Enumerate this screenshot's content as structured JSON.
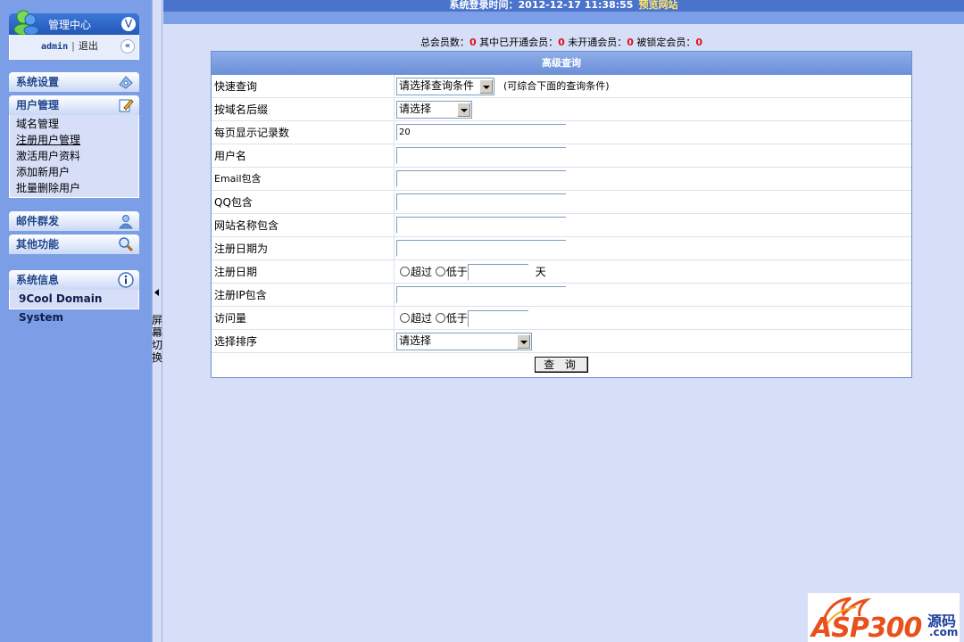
{
  "sidebar": {
    "manager": {
      "title": "管理中心",
      "user": "admin",
      "logout": "退出"
    },
    "sections": [
      {
        "title": "系统设置"
      },
      {
        "title": "用户管理",
        "items": [
          "域名管理",
          "注册用户管理",
          "激活用户资料",
          "添加新用户",
          "批量删除用户"
        ]
      },
      {
        "title": "邮件群发"
      },
      {
        "title": "其他功能"
      },
      {
        "title": "系统信息",
        "items": [
          "9Cool Domain System"
        ]
      }
    ]
  },
  "splitter": {
    "label": "屏幕切换"
  },
  "topbar": {
    "login_time": "系统登录时间：2012-12-17 11:38:55",
    "preview": "预览网站"
  },
  "stats": {
    "total_label": "总会员数：",
    "total": "0",
    "active_label": "其中已开通会员：",
    "active": "0",
    "inactive_label": "未开通会员：",
    "inactive": "0",
    "locked_label": "被锁定会员：",
    "locked": "0"
  },
  "query": {
    "title": "高级查询",
    "quick": {
      "label": "快速查询",
      "value": "请选择查询条件",
      "hint": "(可综合下面的查询条件)"
    },
    "suffix": {
      "label": "按域名后缀",
      "value": "请选择"
    },
    "per_page": {
      "label": "每页显示记录数",
      "value": "20"
    },
    "username": {
      "label": "用户名",
      "value": ""
    },
    "email": {
      "label": "Email包含",
      "value": ""
    },
    "qq": {
      "label": "QQ包含",
      "value": ""
    },
    "site_name": {
      "label": "网站名称包含",
      "value": ""
    },
    "reg_date_is": {
      "label": "注册日期为",
      "value": ""
    },
    "reg_date": {
      "label": "注册日期",
      "over": "超过",
      "under": "低于",
      "unit": "天"
    },
    "reg_ip": {
      "label": "注册IP包含",
      "value": ""
    },
    "visits": {
      "label": "访问量",
      "over": "超过",
      "under": "低于"
    },
    "sort": {
      "label": "选择排序",
      "value": "请选择"
    },
    "submit": "查 询"
  },
  "logo": {
    "brand": "ASP300",
    "tag": "源码",
    "domain": ".com"
  }
}
